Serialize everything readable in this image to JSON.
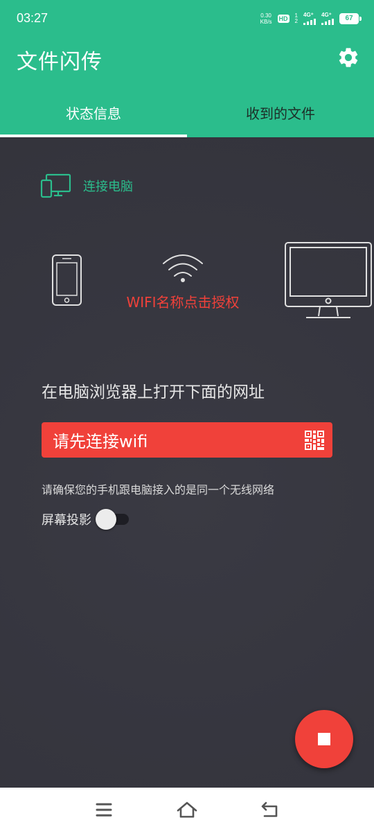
{
  "status_bar": {
    "time": "03:27",
    "net_speed_value": "0.30",
    "net_speed_unit": "KB/s",
    "hd_badge": "HD",
    "sim_sup_1": "1",
    "sim_sup_2": "2",
    "network_1": "4G⁺",
    "network_2": "4G⁺",
    "battery": "67"
  },
  "header": {
    "app_title": "文件闪传",
    "settings_icon": "gear-icon"
  },
  "tabs": [
    {
      "label": "状态信息",
      "selected": true
    },
    {
      "label": "收到的文件",
      "selected": false
    }
  ],
  "connection": {
    "connect_label": "连接电脑",
    "wifi_hint": "WIFI名称点击授权",
    "instruction": "在电脑浏览器上打开下面的网址",
    "url_text": "请先连接wifi",
    "qr_icon": "qr-code-icon",
    "same_network_note": "请确保您的手机跟电脑接入的是同一个无线网络",
    "projection_label": "屏幕投影",
    "projection_enabled": false
  },
  "fab": {
    "icon": "stop-icon"
  },
  "colors": {
    "accent": "#2bbd8c",
    "danger": "#f0413a",
    "background": "#36363f"
  },
  "nav_bar": {
    "menu_icon": "menu-icon",
    "home_icon": "home-icon",
    "back_icon": "back-icon"
  }
}
